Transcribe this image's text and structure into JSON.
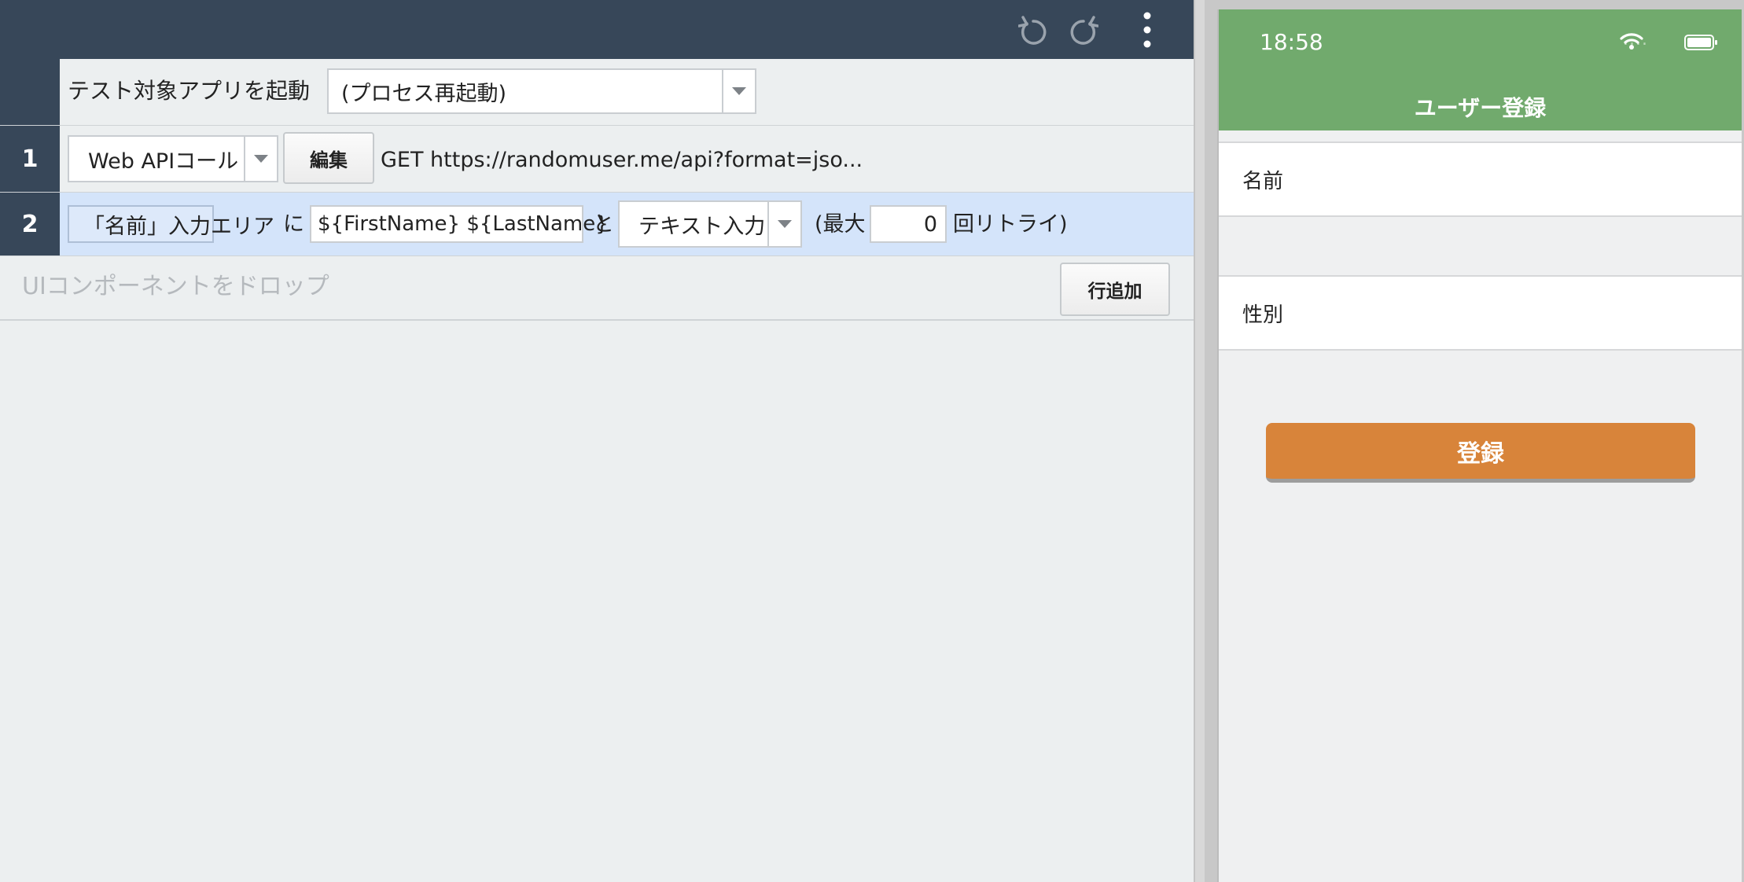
{
  "toolbar": {
    "undo_icon": "undo-icon",
    "redo_icon": "redo-icon",
    "more_icon": "more-vertical-icon"
  },
  "launch_row": {
    "label": "テスト対象アプリを起動",
    "select_value": "(プロセス再起動)"
  },
  "steps": [
    {
      "number": "1",
      "action_value": "Web APIコール",
      "edit_label": "編集",
      "summary": "GET https://randomuser.me/api?format=jso..."
    },
    {
      "number": "2",
      "target": "「名前」入力エリア",
      "particle_ni": "に",
      "text_value": "${FirstName} ${LastName}",
      "particle_to": "と",
      "action_value": "テキスト入力",
      "retry_prefix": "(最大",
      "retry_value": "0",
      "retry_suffix": "回リトライ)"
    }
  ],
  "drop_row": {
    "placeholder": "UIコンポーネントをドロップ",
    "add_row_label": "行追加"
  },
  "phone": {
    "time": "18:58",
    "signal_dots": "....",
    "title": "ユーザー登録",
    "fields": [
      {
        "label": "名前"
      },
      {
        "label": "性別"
      }
    ],
    "submit_label": "登録"
  },
  "colors": {
    "editor_header": "#374759",
    "row_selected": "#d4e4fa",
    "phone_navbar": "#71aa6d",
    "submit_button": "#d8843a"
  }
}
